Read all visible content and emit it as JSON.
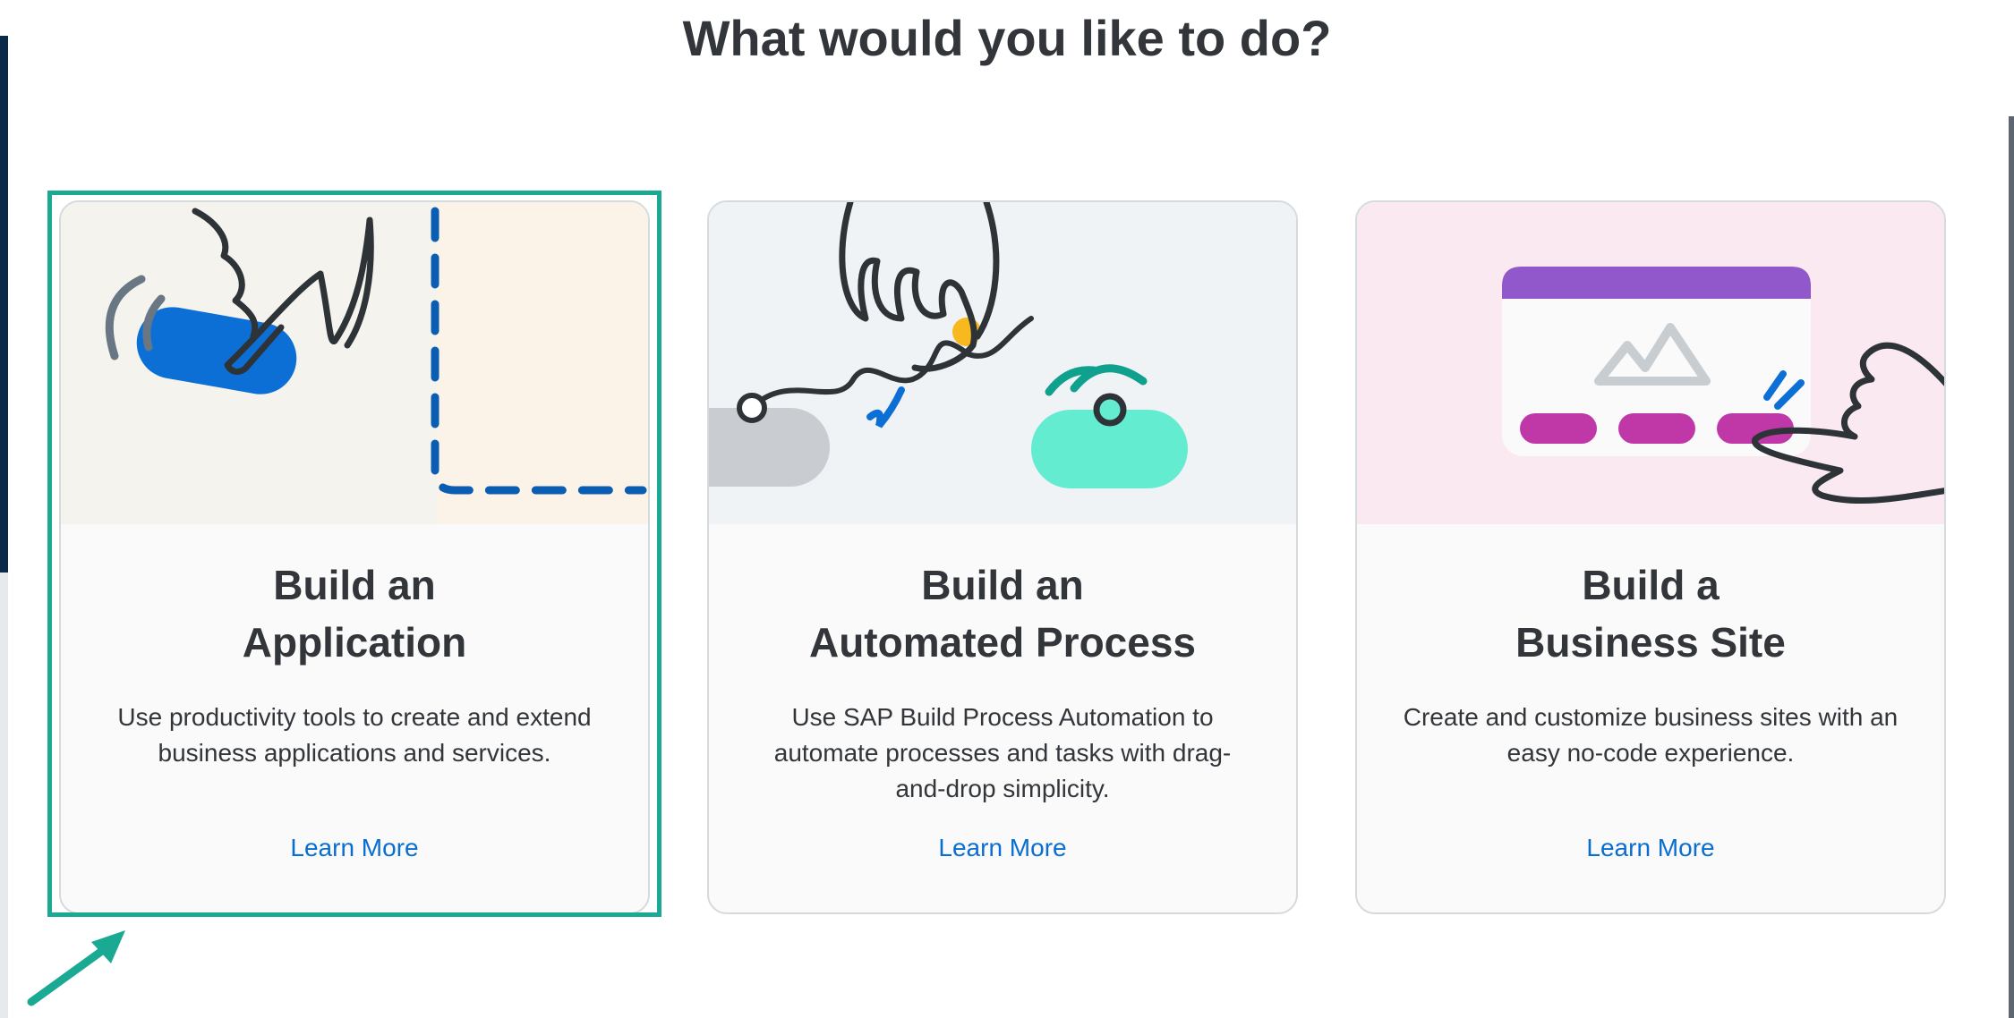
{
  "page": {
    "title": "What would you like to do?"
  },
  "cards": [
    {
      "title_line1": "Build an",
      "title_line2": "Application",
      "description": "Use productivity tools to create and extend business applications and services.",
      "link": "Learn More",
      "illustration": "hand-pressing-button-icon",
      "background": "#f5f3ee"
    },
    {
      "title_line1": "Build an",
      "title_line2": "Automated Process",
      "description": "Use SAP Build Process Automation to automate processes and tasks with drag-and-drop simplicity.",
      "link": "Learn More",
      "illustration": "hand-connecting-wire-icon",
      "background": "#eff3f6"
    },
    {
      "title_line1": "Build a",
      "title_line2": "Business Site",
      "description": "Create and customize business sites with an easy no-code experience.",
      "link": "Learn More",
      "illustration": "hand-tapping-website-icon",
      "background": "#fbe9f1"
    }
  ],
  "colors": {
    "accent": "#0a6ed1",
    "highlight": "#1aa992",
    "text": "#32363a"
  }
}
